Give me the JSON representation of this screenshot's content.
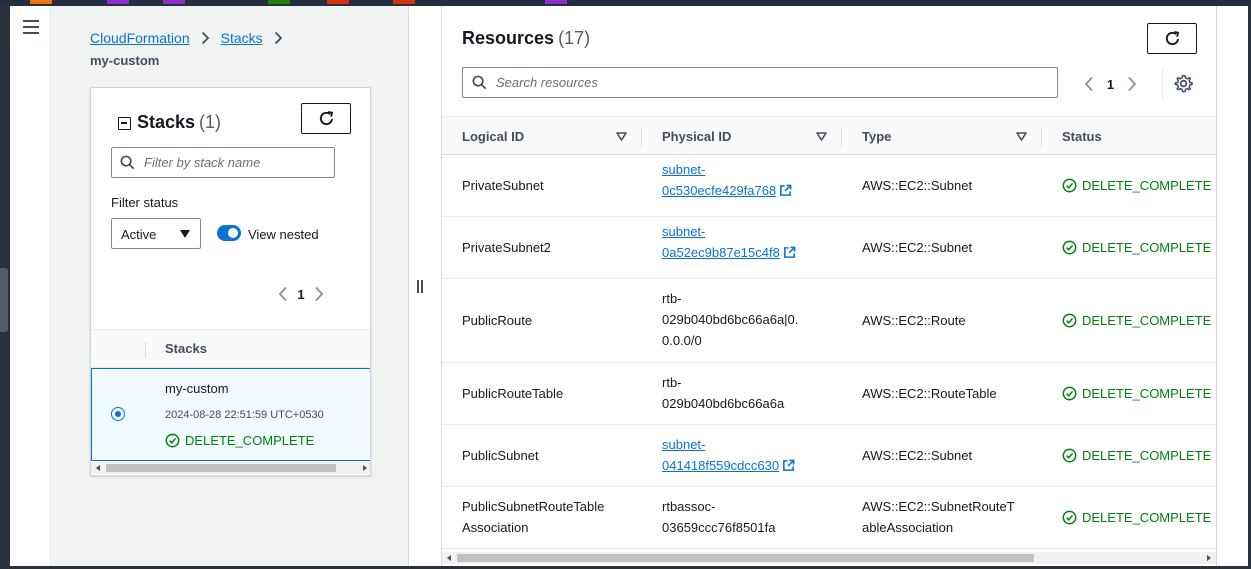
{
  "colors": {
    "link": "#0972d3",
    "success": "#037f0c",
    "selected_bg": "#f1faff",
    "topbar": "#232f3e"
  },
  "nav": {
    "menu_icon": "hamburger-menu-icon"
  },
  "breadcrumb": {
    "items": [
      "CloudFormation",
      "Stacks"
    ],
    "current": "my-custom"
  },
  "stacks_panel": {
    "title": "Stacks",
    "count": "(1)",
    "search": {
      "placeholder": "Filter by stack name",
      "value": ""
    },
    "filter_status_label": "Filter status",
    "filter_status_value": "Active",
    "view_nested_label": "View nested",
    "view_nested_on": true,
    "page": "1",
    "column_header": "Stacks",
    "rows": [
      {
        "name": "my-custom",
        "created": "2024-08-28 22:51:59 UTC+0530",
        "status": "DELETE_COMPLETE",
        "selected": true
      }
    ]
  },
  "resources_panel": {
    "title": "Resources",
    "count": "(17)",
    "search": {
      "placeholder": "Search resources",
      "value": ""
    },
    "page": "1",
    "columns": [
      "Logical ID",
      "Physical ID",
      "Type",
      "Status"
    ],
    "rows": [
      {
        "logical_id": "PrivateSubnet",
        "physical_id_lines": [
          "subnet-",
          "0c530ecfe429fa768"
        ],
        "physical_is_link": true,
        "type_lines": [
          "AWS::EC2::Subnet"
        ],
        "status": "DELETE_COMPLETE"
      },
      {
        "logical_id": "PrivateSubnet2",
        "physical_id_lines": [
          "subnet-",
          "0a52ec9b87e15c4f8"
        ],
        "physical_is_link": true,
        "type_lines": [
          "AWS::EC2::Subnet"
        ],
        "status": "DELETE_COMPLETE"
      },
      {
        "logical_id": "PublicRoute",
        "physical_id_lines": [
          "rtb-",
          "029b040bd6bc66a6a|0.",
          "0.0.0/0"
        ],
        "physical_is_link": false,
        "type_lines": [
          "AWS::EC2::Route"
        ],
        "status": "DELETE_COMPLETE"
      },
      {
        "logical_id": "PublicRouteTable",
        "physical_id_lines": [
          "rtb-",
          "029b040bd6bc66a6a"
        ],
        "physical_is_link": false,
        "type_lines": [
          "AWS::EC2::RouteTable"
        ],
        "status": "DELETE_COMPLETE"
      },
      {
        "logical_id": "PublicSubnet",
        "physical_id_lines": [
          "subnet-",
          "041418f559cdcc630"
        ],
        "physical_is_link": true,
        "type_lines": [
          "AWS::EC2::Subnet"
        ],
        "status": "DELETE_COMPLETE"
      },
      {
        "logical_id_lines": [
          "PublicSubnetRouteTable",
          "Association"
        ],
        "physical_id_lines": [
          "rtbassoc-",
          "03659ccc76f8501fa"
        ],
        "physical_is_link": false,
        "type_lines": [
          "AWS::EC2::SubnetRouteT",
          "ableAssociation"
        ],
        "status": "DELETE_COMPLETE"
      }
    ]
  }
}
